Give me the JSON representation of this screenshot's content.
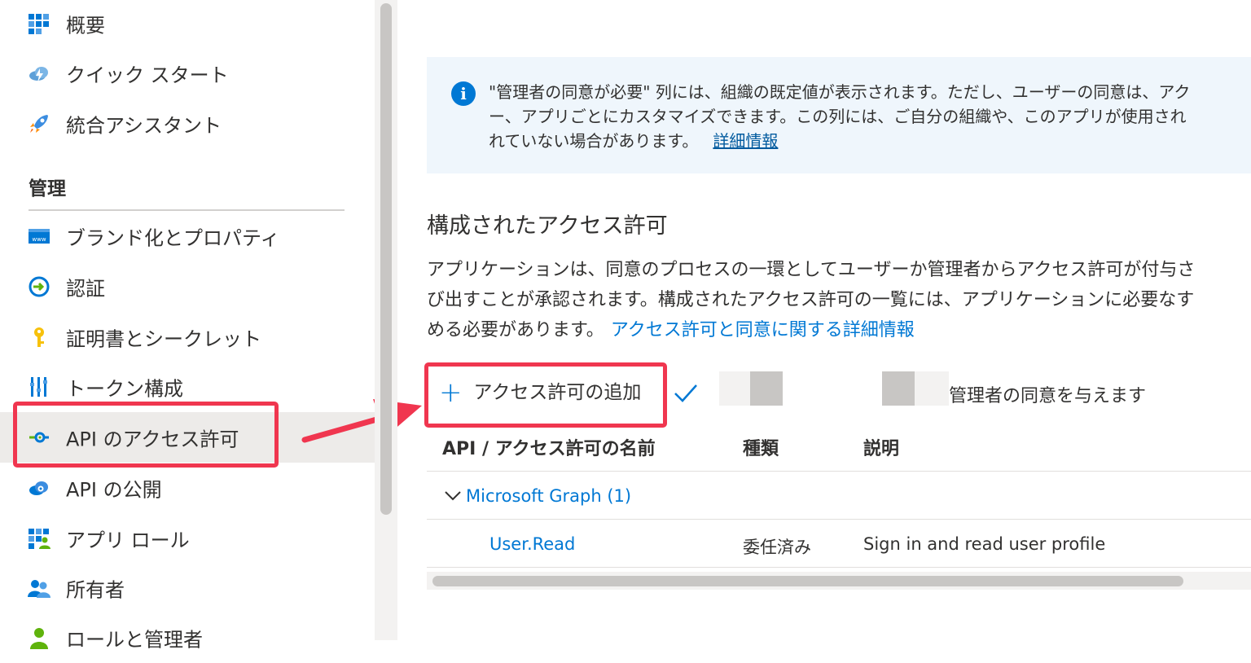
{
  "sidebar": {
    "items": [
      {
        "label": "概要",
        "icon": "overview-grid-icon"
      },
      {
        "label": "クイック スタート",
        "icon": "cloud-lightning-icon"
      },
      {
        "label": "統合アシスタント",
        "icon": "rocket-icon"
      },
      {
        "label": "ブランド化とプロパティ",
        "icon": "www-window-icon"
      },
      {
        "label": "認証",
        "icon": "sign-in-arrow-icon"
      },
      {
        "label": "証明書とシークレット",
        "icon": "key-icon"
      },
      {
        "label": "トークン構成",
        "icon": "token-bars-icon"
      },
      {
        "label": "API のアクセス許可",
        "icon": "api-permission-icon"
      },
      {
        "label": "API の公開",
        "icon": "cloud-gear-icon"
      },
      {
        "label": "アプリ ロール",
        "icon": "app-roles-icon"
      },
      {
        "label": "所有者",
        "icon": "users-icon"
      },
      {
        "label": "ロールと管理者",
        "icon": "user-admin-icon"
      }
    ],
    "section_header": "管理",
    "selected_index": 7
  },
  "info": {
    "line1": "\"管理者の同意が必要\" 列には、組織の既定値が表示されます。ただし、ユーザーの同意は、アク",
    "line2": "ー、アプリごとにカスタマイズできます。この列には、ご自分の組織や、このアプリが使用され",
    "line3": "れていない場合があります。",
    "link": "詳細情報"
  },
  "main": {
    "section_title": "構成されたアクセス許可",
    "desc_line1": "アプリケーションは、同意のプロセスの一環としてユーザーか管理者からアクセス許可が付与さ",
    "desc_line2": "び出すことが承認されます。構成されたアクセス許可の一覧には、アプリケーションに必要なす",
    "desc_line3": "める必要があります。",
    "desc_link": "アクセス許可と同意に関する詳細情報"
  },
  "toolbar": {
    "add_permission": "アクセス許可の追加",
    "grant_consent": "管理者の同意を与えます"
  },
  "table": {
    "headers": [
      "API / アクセス許可の名前",
      "種類",
      "説明"
    ],
    "groups": [
      {
        "name": "Microsoft Graph (1)",
        "rows": [
          {
            "permission": "User.Read",
            "type": "委任済み",
            "description": "Sign in and read user profile"
          }
        ]
      }
    ]
  },
  "colors": {
    "accent": "#0078d4",
    "highlight": "#f0364f",
    "info_bg": "#eff6fc",
    "selected_bg": "#edebe9"
  }
}
